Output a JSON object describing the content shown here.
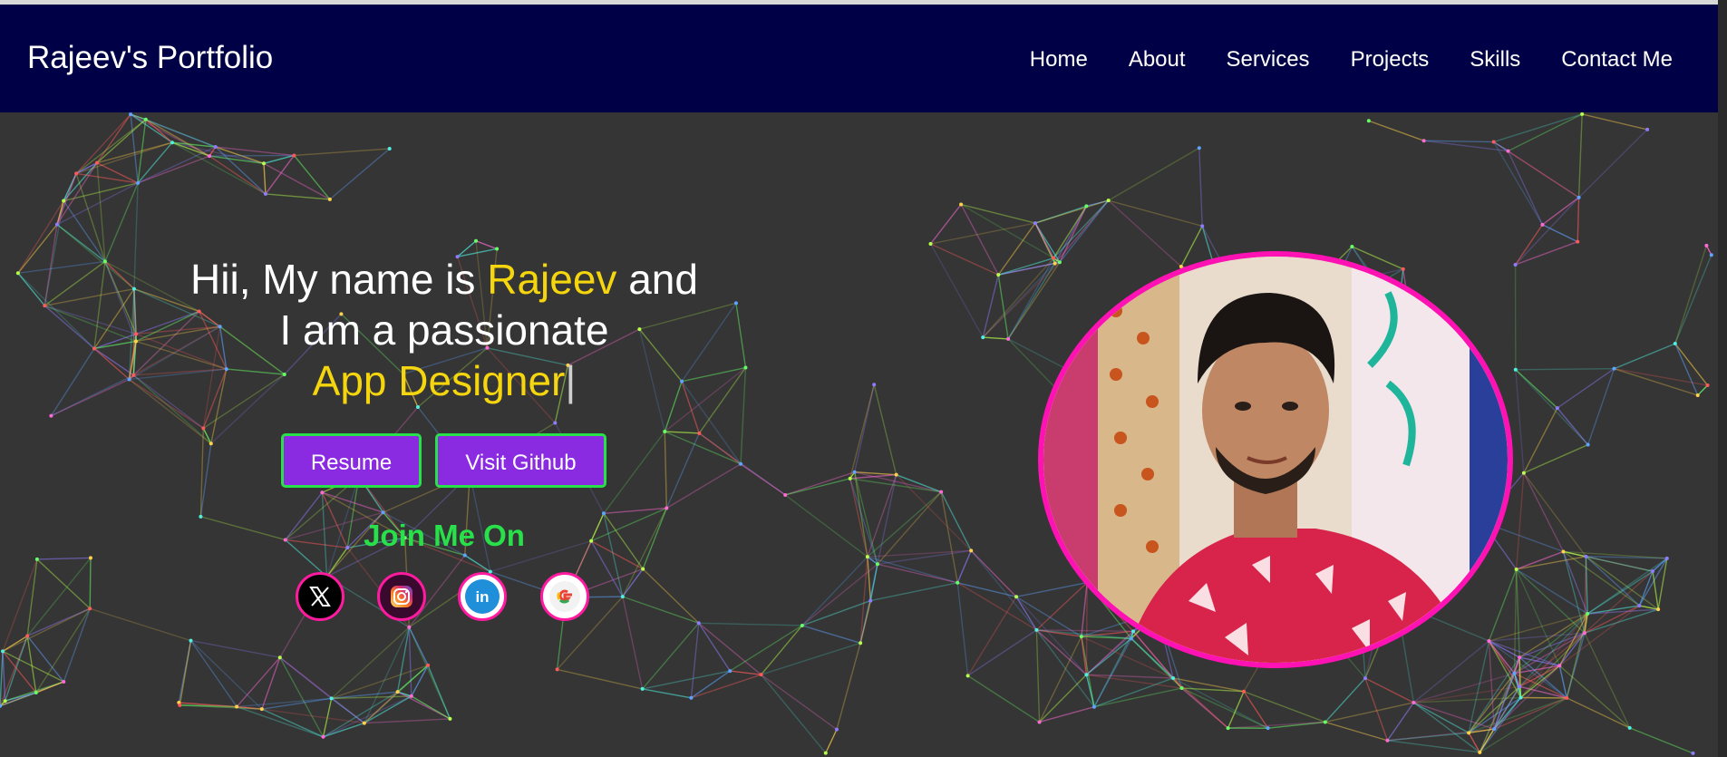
{
  "navbar": {
    "brand": "Rajeev's Portfolio",
    "items": [
      "Home",
      "About",
      "Services",
      "Projects",
      "Skills",
      "Contact Me"
    ]
  },
  "hero": {
    "greeting_pre": "Hii, My name is ",
    "name": "Rajeev",
    "greeting_post": " and",
    "line2": "I am a passionate",
    "role": "App Designer",
    "cursor": "|"
  },
  "buttons": {
    "resume": "Resume",
    "github": "Visit Github"
  },
  "social": {
    "heading": "Join Me On",
    "icons": [
      "x-icon",
      "instagram-icon",
      "linkedin-icon",
      "google-icon"
    ],
    "linkedin_text": "in"
  },
  "colors": {
    "navbar_bg": "#000046",
    "page_bg": "#353535",
    "highlight": "#f5d50e",
    "button_bg": "#8a2be2",
    "button_border": "#28e04a",
    "accent_pink": "#ff12b4"
  }
}
